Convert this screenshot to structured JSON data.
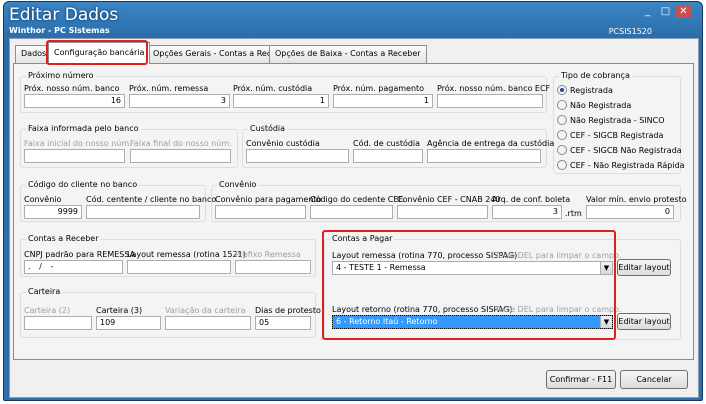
{
  "window": {
    "title": "Editar Dados",
    "subtitle": "Winthor - PC Sistemas",
    "code": "PCSIS1520"
  },
  "tabs": [
    "Dados",
    "Configuração bancária",
    "Opções Gerais - Contas a Receber",
    "Opções de Baixa - Contas a Receber"
  ],
  "proximo": {
    "title": "Próximo número",
    "labels": [
      "Próx. nosso núm. banco",
      "Próx. núm. remessa",
      "Próx. núm. custódia",
      "Próx. núm. pagamento",
      "Próx. nosso núm. banco ECF"
    ],
    "values": [
      "16",
      "3",
      "1",
      "1",
      ""
    ]
  },
  "tipo": {
    "title": "Tipo de cobrança",
    "options": [
      "Registrada",
      "Não Registrada",
      "Não Registrada - SINCO",
      "CEF - SIGCB Registrada",
      "CEF - SIGCB Não Registrada",
      "CEF - Não Registrada Rápida"
    ]
  },
  "faixa": {
    "title": "Faixa informada pelo banco",
    "l1": "Faixa inicial do nosso núm.",
    "l2": "Faixa final do nosso núm."
  },
  "custodia": {
    "title": "Custódia",
    "l1": "Convênio custódia",
    "l2": "Cód. de custódia",
    "l3": "Agência de entrega da custódia"
  },
  "codcli": {
    "title": "Código do cliente no banco",
    "l1": "Convênio",
    "v1": "9999",
    "l2": "Cód. centente / cliente no banco"
  },
  "conv": {
    "title": "Convênio",
    "l1": "Convênio para pagamento",
    "l2": "Código do cedente CEF.",
    "l3": "Convênio CEF - CNAB 240",
    "l4": "Arq. de conf. boleta",
    "v4": "3",
    "ext": ".rtm",
    "l5": "Valor mín. envio protesto",
    "v5": "0"
  },
  "receber": {
    "title": "Contas a Receber",
    "l1": "CNPJ padrão para REMESSA",
    "v1": ". / -",
    "l2": "Layout remessa (rotina 1521)",
    "l3": "Prefixo Remessa"
  },
  "carteira": {
    "title": "Carteira",
    "l1": "Carteira (2)",
    "l2": "Carteira (3)",
    "v2": "109",
    "l3": "Variação da carteira",
    "l4": "Dias de protesto",
    "v4": "05"
  },
  "pagar": {
    "title": "Contas a Pagar",
    "l1": "Layout remessa (rotina 770, processo SISPAG)",
    "hint": "Tecle DEL para limpar o campo.",
    "v1": "4 - TESTE 1 - Remessa",
    "l2": "Layout retorno (rotina 770, processo SISPAG)",
    "v2": "6 - Retorno Itaú - Retorno",
    "btn": "Editar layout"
  },
  "footer": {
    "confirm": "Confirmar - F11",
    "cancel": "Cancelar"
  },
  "window_buttons": [
    "_",
    "□",
    "✕"
  ]
}
